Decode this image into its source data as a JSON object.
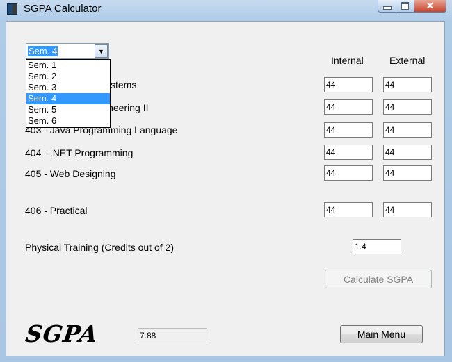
{
  "window": {
    "title": "SGPA Calculator"
  },
  "semester": {
    "selected": "Sem. 4",
    "options": [
      "Sem. 1",
      "Sem. 2",
      "Sem. 3",
      "Sem. 4",
      "Sem. 5",
      "Sem. 6"
    ]
  },
  "headers": {
    "internal": "Internal",
    "external": "External"
  },
  "subjects": [
    {
      "label": "ystems",
      "internal": "44",
      "external": "44"
    },
    {
      "label": "ineering II",
      "internal": "44",
      "external": "44"
    },
    {
      "label": "403 - Java Programming Language",
      "internal": "44",
      "external": "44"
    },
    {
      "label": "404 - .NET Programming",
      "internal": "44",
      "external": "44"
    },
    {
      "label": "405 - Web Designing",
      "internal": "44",
      "external": "44"
    },
    {
      "label": "406 - Practical",
      "internal": "44",
      "external": "44"
    }
  ],
  "physical_training": {
    "label": "Physical Training (Credits out of 2)",
    "value": "1.4"
  },
  "buttons": {
    "calculate": "Calculate SGPA",
    "main_menu": "Main Menu"
  },
  "result": {
    "logo_text": "SGPA",
    "value": "7.88"
  }
}
